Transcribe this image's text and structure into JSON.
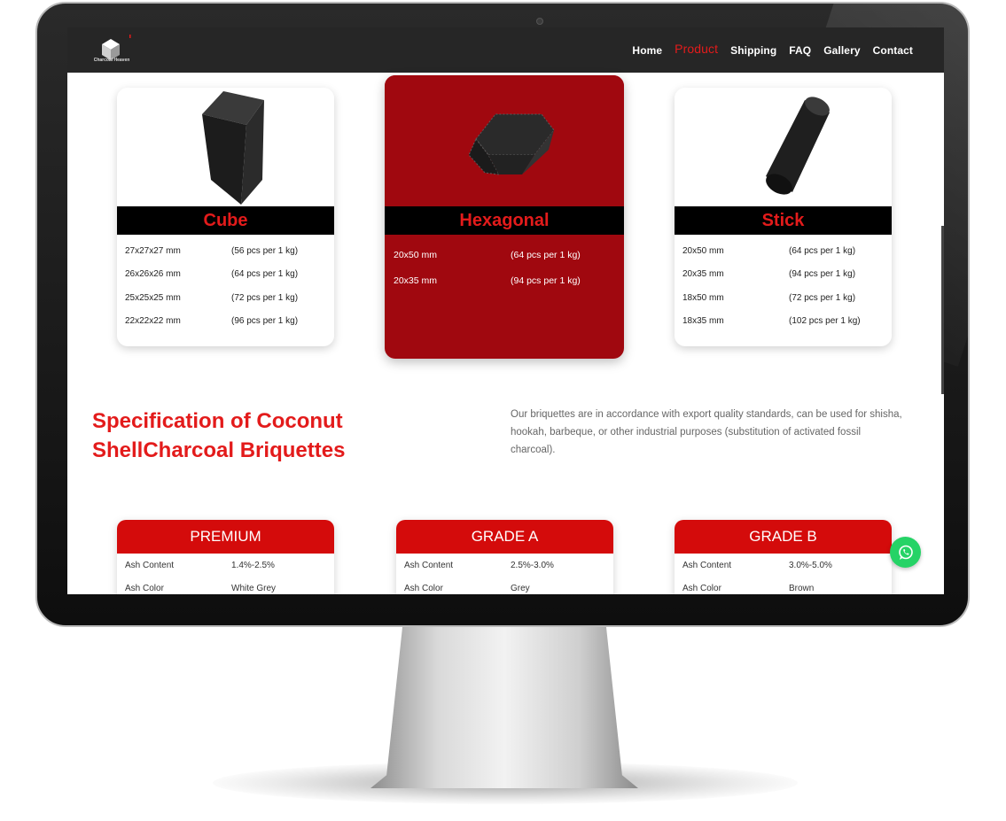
{
  "brand": {
    "name": "Charcoal Heaven"
  },
  "nav": {
    "items": [
      {
        "label": "Home",
        "active": false
      },
      {
        "label": "Product",
        "active": true
      },
      {
        "label": "Shipping",
        "active": false
      },
      {
        "label": "FAQ",
        "active": false
      },
      {
        "label": "Gallery",
        "active": false
      },
      {
        "label": "Contact",
        "active": false
      }
    ]
  },
  "products": [
    {
      "name": "Cube",
      "rows": [
        {
          "size": "27x27x27 mm",
          "qty": "(56 pcs per 1 kg)"
        },
        {
          "size": "26x26x26 mm",
          "qty": "(64 pcs per 1 kg)"
        },
        {
          "size": "25x25x25 mm",
          "qty": "(72 pcs per 1 kg)"
        },
        {
          "size": "22x22x22 mm",
          "qty": "(96 pcs per 1 kg)"
        }
      ]
    },
    {
      "name": "Hexagonal",
      "rows": [
        {
          "size": "20x50 mm",
          "qty": "(64 pcs per 1 kg)"
        },
        {
          "size": "20x35 mm",
          "qty": "(94 pcs per 1 kg)"
        }
      ]
    },
    {
      "name": "Stick",
      "rows": [
        {
          "size": "20x50 mm",
          "qty": "(64 pcs per 1 kg)"
        },
        {
          "size": "20x35 mm",
          "qty": "(94 pcs per 1 kg)"
        },
        {
          "size": "18x50 mm",
          "qty": "(72 pcs per 1 kg)"
        },
        {
          "size": "18x35 mm",
          "qty": "(102 pcs per 1 kg)"
        }
      ]
    }
  ],
  "spec": {
    "title": "Specification of Coconut ShellCharcoal Briquettes",
    "description": "Our briquettes are in accordance with export quality standards, can be used for shisha, hookah, barbeque, or other industrial purposes (substitution of activated fossil charcoal)."
  },
  "grades": [
    {
      "name": "PREMIUM",
      "rows": [
        {
          "label": "Ash Content",
          "value": "1.4%-2.5%"
        },
        {
          "label": "Ash Color",
          "value": "White Grey"
        }
      ]
    },
    {
      "name": "GRADE A",
      "rows": [
        {
          "label": "Ash Content",
          "value": "2.5%-3.0%"
        },
        {
          "label": "Ash Color",
          "value": "Grey"
        }
      ]
    },
    {
      "name": "GRADE B",
      "rows": [
        {
          "label": "Ash Content",
          "value": "3.0%-5.0%"
        },
        {
          "label": "Ash Color",
          "value": "Brown"
        }
      ]
    }
  ],
  "colors": {
    "accent": "#e31b1b",
    "featured": "#a0080f",
    "navbar": "#262626",
    "whatsapp": "#25d366"
  },
  "icons": {
    "whatsapp": "whatsapp-icon",
    "logo": "cube-logo-icon"
  }
}
